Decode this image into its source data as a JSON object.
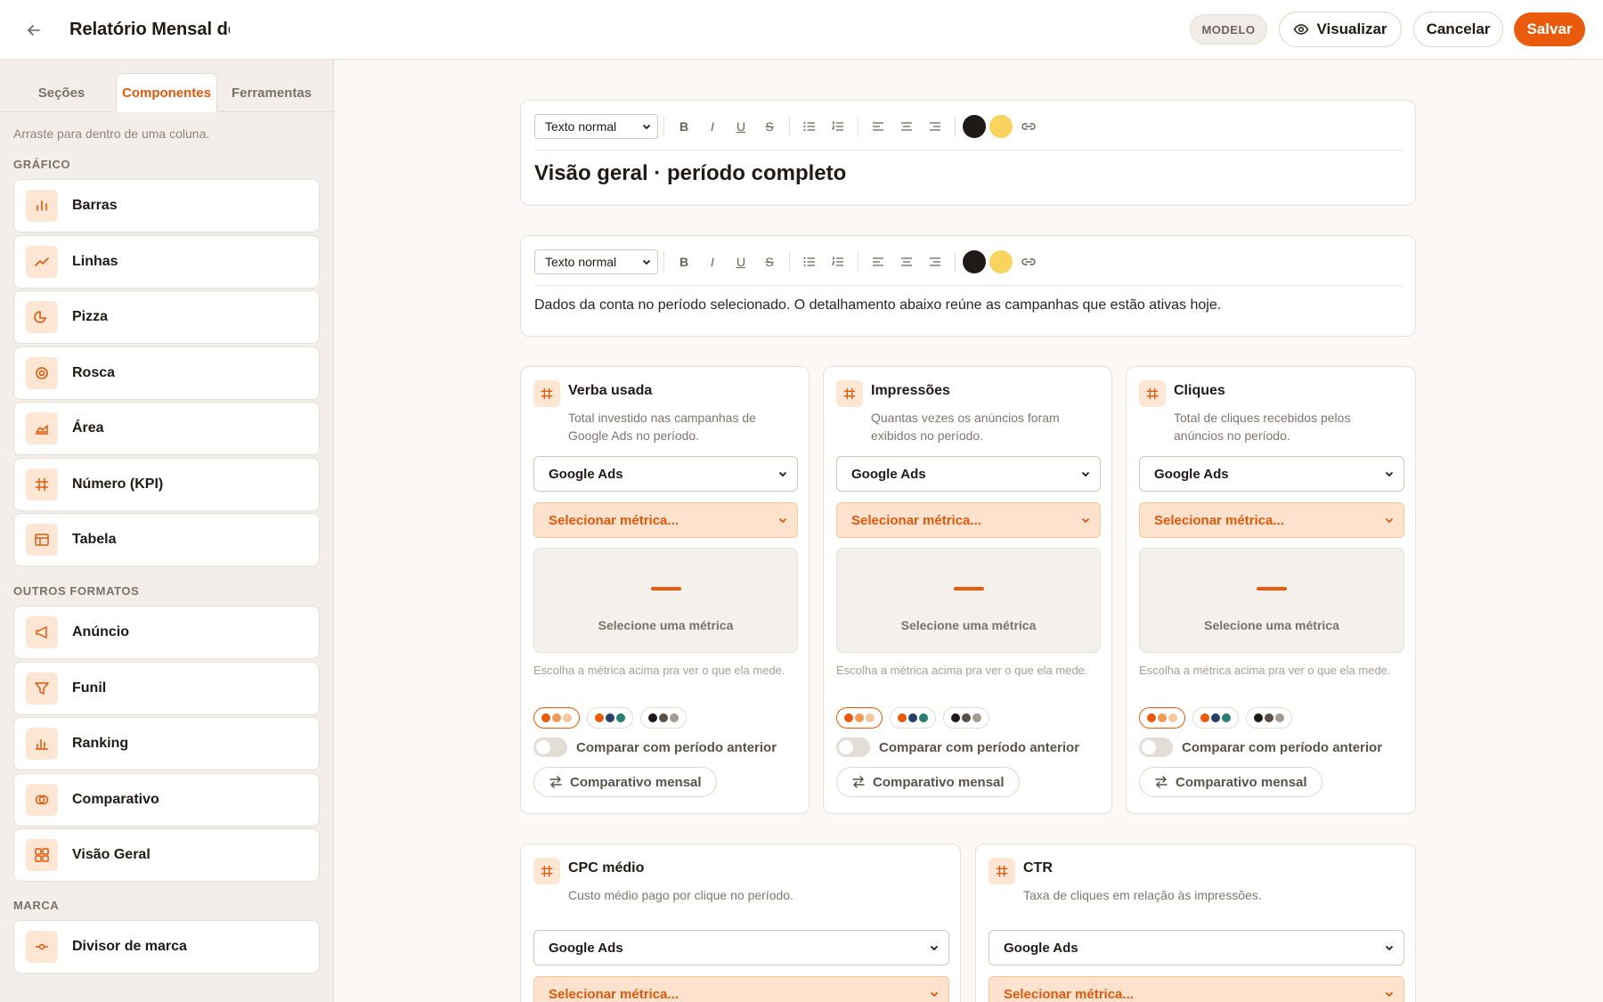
{
  "header": {
    "title": "Relatório Mensal de",
    "badge": "MODELO",
    "preview_label": "Visualizar",
    "cancel_label": "Cancelar",
    "save_label": "Salvar"
  },
  "sidebar": {
    "tabs": [
      "Seções",
      "Componentes",
      "Ferramentas"
    ],
    "active_tab": "Componentes",
    "hint": "Arraste para dentro de uma coluna.",
    "groups": [
      {
        "label": "GRÁFICO",
        "items": [
          {
            "label": "Barras",
            "icon": "bar-chart-icon"
          },
          {
            "label": "Linhas",
            "icon": "line-chart-icon"
          },
          {
            "label": "Pizza",
            "icon": "pie-chart-icon"
          },
          {
            "label": "Rosca",
            "icon": "donut-chart-icon"
          },
          {
            "label": "Área",
            "icon": "area-chart-icon"
          },
          {
            "label": "Número (KPI)",
            "icon": "hash-icon"
          },
          {
            "label": "Tabela",
            "icon": "table-icon"
          }
        ]
      },
      {
        "label": "OUTROS FORMATOS",
        "items": [
          {
            "label": "Anúncio",
            "icon": "megaphone-icon"
          },
          {
            "label": "Funil",
            "icon": "funnel-icon"
          },
          {
            "label": "Ranking",
            "icon": "ranking-icon"
          },
          {
            "label": "Comparativo",
            "icon": "compare-icon"
          },
          {
            "label": "Visão Geral",
            "icon": "grid-icon"
          }
        ]
      },
      {
        "label": "MARCA",
        "items": [
          {
            "label": "Divisor de marca",
            "icon": "brand-divider-icon"
          }
        ]
      }
    ]
  },
  "editor": {
    "format_select": "Texto normal",
    "heading_block": "Visão geral · período completo",
    "paragraph_block": "Dados da conta no período selecionado. O detalhamento abaixo reúne as campanhas que estão ativas hoje.",
    "colors": [
      "#1f1a17",
      "#f8d35e"
    ]
  },
  "kpi_defaults": {
    "source": "Google Ads",
    "metric_placeholder": "Selecionar métrica...",
    "preview_text": "Selecione uma métrica",
    "metric_hint": "Escolha a métrica acima pra ver o que ela mede.",
    "compare_label": "Comparar com período anterior",
    "monthly_label": "Comparativo mensal",
    "palettes": [
      [
        "#ea5a0c",
        "#f19a58",
        "#f7c7a0"
      ],
      [
        "#ea5a0c",
        "#2a3f66",
        "#2a7f73"
      ],
      [
        "#1f1a17",
        "#5a4f47",
        "#a49a91"
      ]
    ]
  },
  "kpis": [
    {
      "title": "Verba usada",
      "desc_1": "Total investido nas campanhas de",
      "desc_2": "Google Ads no período."
    },
    {
      "title": "Impressões",
      "desc_1": "Quantas vezes os anúncios foram",
      "desc_2": "exibidos no período."
    },
    {
      "title": "Cliques",
      "desc_1": "Total de cliques recebidos pelos",
      "desc_2": "anúncios no período."
    },
    {
      "title": "CPC médio",
      "desc_1": "Custo médio pago por clique no período.",
      "desc_2": ""
    },
    {
      "title": "CTR",
      "desc_1": "Taxa de cliques em relação às impressões.",
      "desc_2": ""
    }
  ]
}
